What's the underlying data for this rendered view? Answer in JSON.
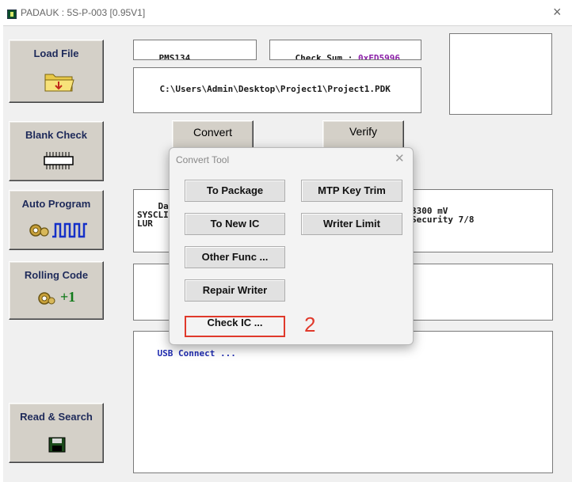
{
  "window": {
    "title": "PADAUK : 5S-P-003 [0.95V1]"
  },
  "sidebar": {
    "load_file": "Load File",
    "blank_check": "Blank Check",
    "auto_program": "Auto Program",
    "rolling_code": "Rolling Code",
    "rolling_plus": "+1",
    "read_search": "Read & Search"
  },
  "main": {
    "ic_name": "PMS134",
    "checksum_label": "Check Sum : ",
    "checksum_value": "0xFD5996",
    "file_path": "C:\\Users\\Admin\\Desktop\\Project1\\Project1.PDK",
    "convert": "Convert",
    "verify": "Verify",
    "info_left": "Date\nSYSCLI\nLUR",
    "info_right": "3300 mV\nSecurity 7/8",
    "log_text": "USB Connect ..."
  },
  "dialog": {
    "title": "Convert Tool",
    "to_package": "To Package",
    "mtp_key_trim": "MTP Key Trim",
    "to_new_ic": "To New IC",
    "writer_limit": "Writer Limit",
    "other_func": "Other Func ...",
    "repair_writer": "Repair Writer",
    "check_ic": "Check IC ..."
  },
  "annotation": {
    "label": "2"
  },
  "colors": {
    "accent_red": "#e0392b",
    "checksum": "#8b1ea8"
  }
}
